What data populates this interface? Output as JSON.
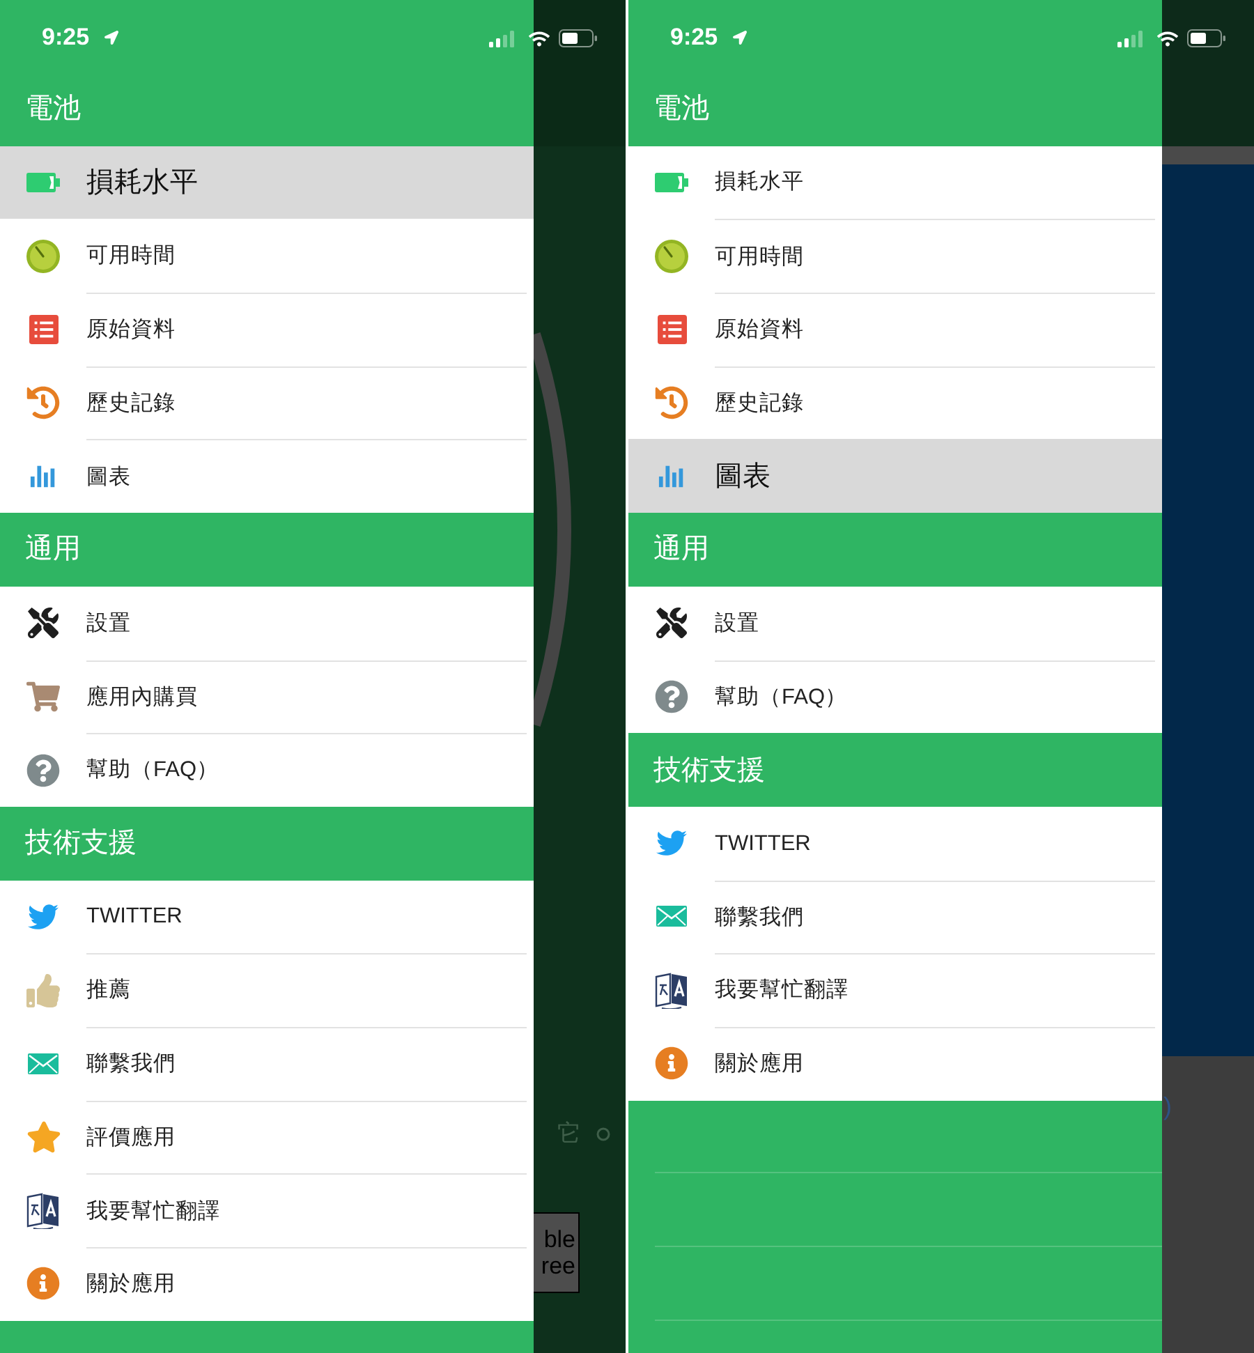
{
  "screens": [
    {
      "status_bar": {
        "time": "9:25"
      },
      "sections": [
        {
          "title": "電池",
          "items": [
            {
              "label": "損耗水平",
              "selected": true
            },
            {
              "label": "可用時間",
              "selected": false
            },
            {
              "label": "原始資料",
              "selected": false
            },
            {
              "label": "歷史記錄",
              "selected": false
            },
            {
              "label": "圖表",
              "selected": false
            }
          ]
        },
        {
          "title": "通用",
          "items": [
            {
              "label": "設置",
              "selected": false
            },
            {
              "label": "應用內購買",
              "selected": false
            },
            {
              "label": "幫助（FAQ）",
              "selected": false
            }
          ]
        },
        {
          "title": "技術支援",
          "items": [
            {
              "label": "TWITTER",
              "selected": false
            },
            {
              "label": "推薦",
              "selected": false
            },
            {
              "label": "聯繫我們",
              "selected": false
            },
            {
              "label": "評價應用",
              "selected": false
            },
            {
              "label": "我要幫忙翻譯",
              "selected": false
            },
            {
              "label": "關於應用",
              "selected": false
            }
          ]
        }
      ],
      "backdrop": {
        "kind": "green",
        "caption": "它",
        "button_lines": [
          "ble",
          "ree"
        ]
      }
    },
    {
      "status_bar": {
        "time": "9:25"
      },
      "sections": [
        {
          "title": "電池",
          "items": [
            {
              "label": "損耗水平",
              "selected": false
            },
            {
              "label": "可用時間",
              "selected": false
            },
            {
              "label": "原始資料",
              "selected": false
            },
            {
              "label": "歷史記錄",
              "selected": false
            },
            {
              "label": "圖表",
              "selected": true
            }
          ]
        },
        {
          "title": "通用",
          "items": [
            {
              "label": "設置",
              "selected": false
            },
            {
              "label": "幫助（FAQ）",
              "selected": false
            }
          ]
        },
        {
          "title": "技術支援",
          "items": [
            {
              "label": "TWITTER",
              "selected": false
            },
            {
              "label": "聯繫我們",
              "selected": false
            },
            {
              "label": "我要幫忙翻譯",
              "selected": false
            },
            {
              "label": "關於應用",
              "selected": false
            }
          ]
        }
      ],
      "backdrop": {
        "kind": "navy",
        "caption": ")"
      }
    }
  ]
}
